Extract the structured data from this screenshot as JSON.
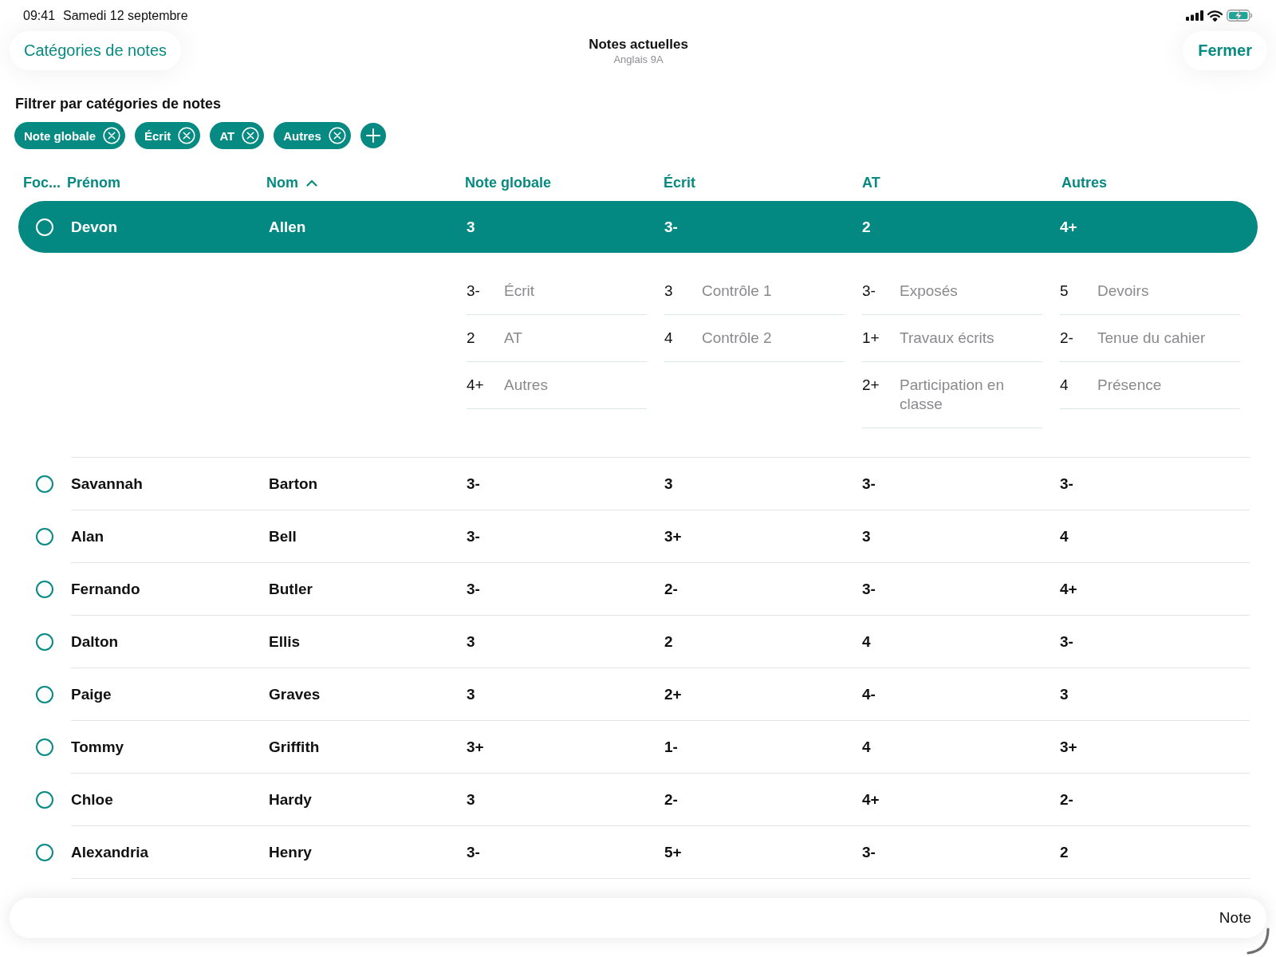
{
  "status_bar": {
    "time": "09:41",
    "date": "Samedi 12 septembre"
  },
  "nav": {
    "back_button": "Catégories de notes",
    "title": "Notes actuelles",
    "subtitle": "Anglais 9A",
    "close_button": "Fermer"
  },
  "filter": {
    "label": "Filtrer par catégories de notes",
    "chips": [
      {
        "label": "Note globale"
      },
      {
        "label": "Écrit"
      },
      {
        "label": "AT"
      },
      {
        "label": "Autres"
      }
    ]
  },
  "table": {
    "columns": [
      {
        "label": "Foc...",
        "sorted": false
      },
      {
        "label": "Prénom",
        "sorted": false
      },
      {
        "label": "Nom",
        "sorted": true
      },
      {
        "label": "Note globale",
        "sorted": false
      },
      {
        "label": "Écrit",
        "sorted": false
      },
      {
        "label": "AT",
        "sorted": false
      },
      {
        "label": "Autres",
        "sorted": false
      }
    ],
    "rows": [
      {
        "first_name": "Devon",
        "last_name": "Allen",
        "grades": [
          "3",
          "3-",
          "2",
          "4+"
        ],
        "selected": true,
        "checked": false,
        "details": [
          [
            {
              "grade": "3-",
              "label": "Écrit"
            },
            {
              "grade": "2",
              "label": "AT"
            },
            {
              "grade": "4+",
              "label": "Autres"
            }
          ],
          [
            {
              "grade": "3",
              "label": "Contrôle 1"
            },
            {
              "grade": "4",
              "label": "Contrôle 2"
            }
          ],
          [
            {
              "grade": "3-",
              "label": "Exposés"
            },
            {
              "grade": "1+",
              "label": "Travaux écrits"
            },
            {
              "grade": "2+",
              "label": "Participation en classe"
            }
          ],
          [
            {
              "grade": "5",
              "label": "Devoirs"
            },
            {
              "grade": "2-",
              "label": "Tenue du cahier"
            },
            {
              "grade": "4",
              "label": "Présence"
            }
          ]
        ]
      },
      {
        "first_name": "Savannah",
        "last_name": "Barton",
        "grades": [
          "3-",
          "3",
          "3-",
          "3-"
        ],
        "selected": false,
        "checked": false
      },
      {
        "first_name": "Alan",
        "last_name": "Bell",
        "grades": [
          "3-",
          "3+",
          "3",
          "4"
        ],
        "selected": false,
        "checked": false
      },
      {
        "first_name": "Fernando",
        "last_name": "Butler",
        "grades": [
          "3-",
          "2-",
          "3-",
          "4+"
        ],
        "selected": false,
        "checked": false
      },
      {
        "first_name": "Dalton",
        "last_name": "Ellis",
        "grades": [
          "3",
          "2",
          "4",
          "3-"
        ],
        "selected": false,
        "checked": false
      },
      {
        "first_name": "Paige",
        "last_name": "Graves",
        "grades": [
          "3",
          "2+",
          "4-",
          "3"
        ],
        "selected": false,
        "checked": false
      },
      {
        "first_name": "Tommy",
        "last_name": "Griffith",
        "grades": [
          "3+",
          "1-",
          "4",
          "3+"
        ],
        "selected": false,
        "checked": false
      },
      {
        "first_name": "Chloe",
        "last_name": "Hardy",
        "grades": [
          "3",
          "2-",
          "4+",
          "2-"
        ],
        "selected": false,
        "checked": false
      },
      {
        "first_name": "Alexandria",
        "last_name": "Henry",
        "grades": [
          "3-",
          "5+",
          "3-",
          "2"
        ],
        "selected": false,
        "checked": false
      }
    ]
  },
  "bottom_bar": {
    "label": "Note"
  }
}
